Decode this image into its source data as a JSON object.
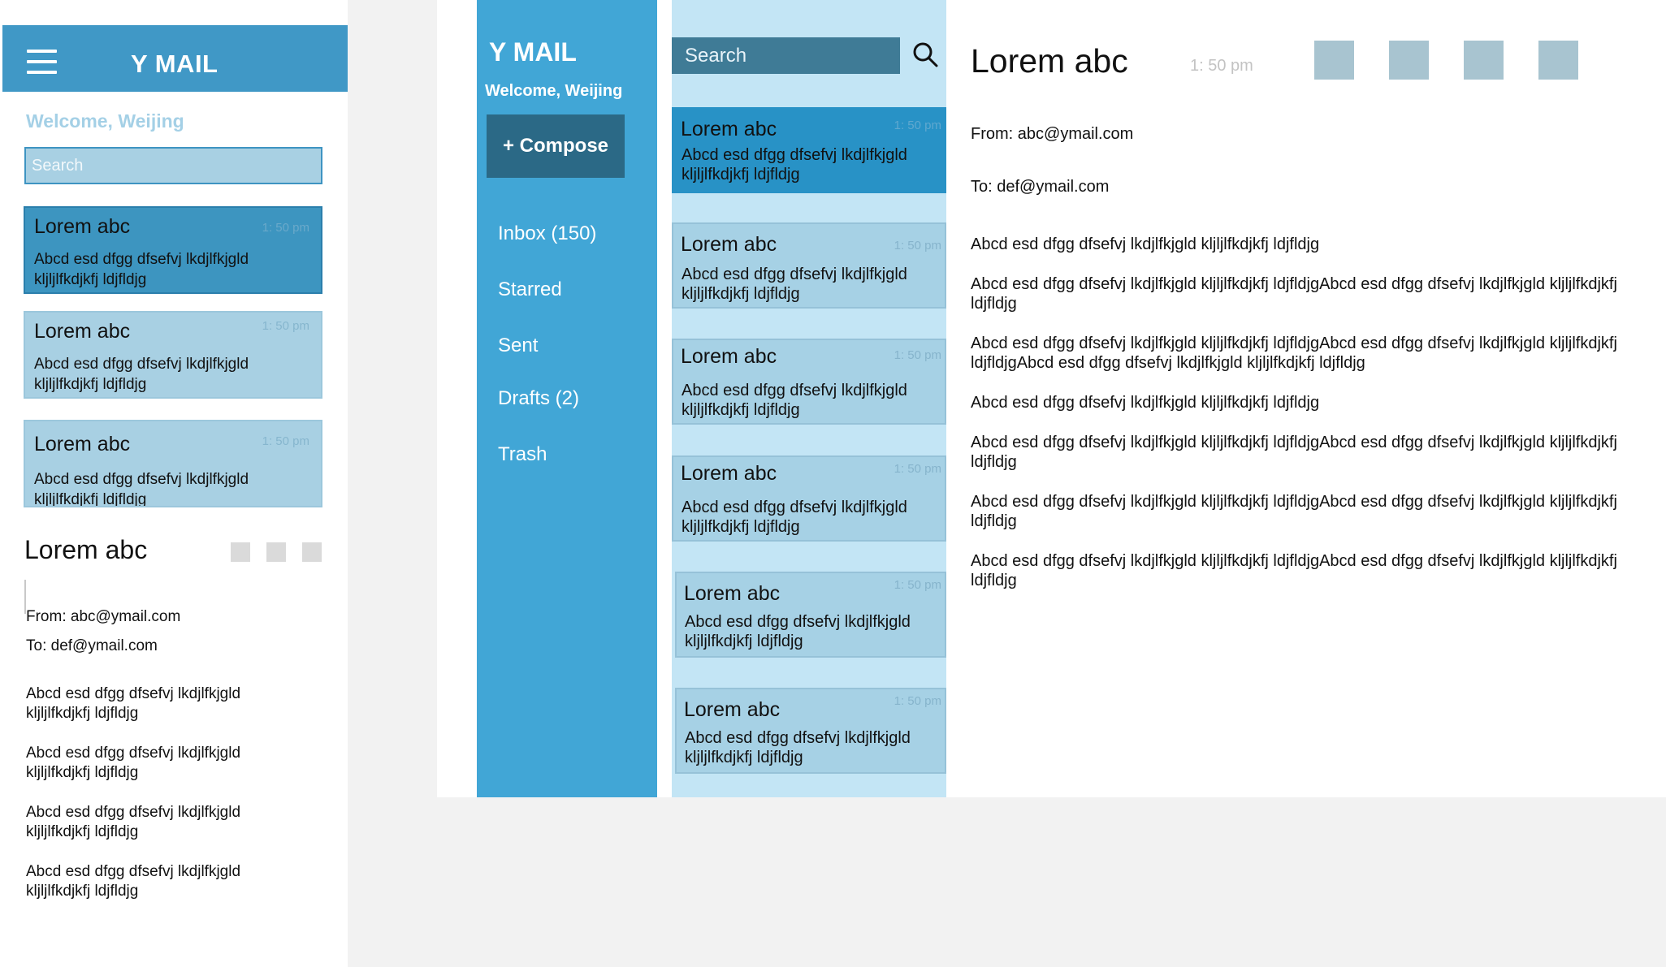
{
  "mobile": {
    "app_title": "Y MAIL",
    "welcome": "Welcome, Weijing",
    "search_placeholder": "Search",
    "emails": [
      {
        "subject": "Lorem abc",
        "time": "1: 50 pm",
        "snippet": "Abcd esd dfgg dfsefvj  lkdjlfkjgld kljljlfkdjkfj ldjfldjg",
        "selected": true
      },
      {
        "subject": "Lorem abc",
        "time": "1: 50 pm",
        "snippet": "Abcd esd dfgg dfsefvj  lkdjlfkjgld kljljlfkdjkfj ldjfldjg",
        "selected": false
      },
      {
        "subject": "Lorem abc",
        "time": "1: 50 pm",
        "snippet": "Abcd esd dfgg dfsefvj  lkdjlfkjgld kljljlfkdjkfj ldjfldjg",
        "selected": false
      }
    ],
    "reader": {
      "subject": "Lorem abc",
      "from": "From: abc@ymail.com",
      "to": "To: def@ymail.com",
      "paragraphs": [
        "Abcd esd dfgg dfsefvj  lkdjlfkjgld kljljlfkdjkfj ldjfldjg",
        "Abcd esd dfgg dfsefvj  lkdjlfkjgld kljljlfkdjkfj ldjfldjg",
        "Abcd esd dfgg dfsefvj  lkdjlfkjgld kljljlfkdjkfj ldjfldjg",
        "Abcd esd dfgg dfsefvj  lkdjlfkjgld kljljlfkdjkfj ldjfldjg"
      ]
    }
  },
  "desktop": {
    "app_title": "Y MAIL",
    "welcome": "Welcome, Weijing",
    "compose_label": "+ Compose",
    "nav": [
      {
        "label": "Inbox (150)"
      },
      {
        "label": "Starred"
      },
      {
        "label": "Sent"
      },
      {
        "label": "Drafts (2)"
      },
      {
        "label": "Trash"
      }
    ],
    "search_placeholder": "Search",
    "emails": [
      {
        "subject": "Lorem abc",
        "time": "1: 50 pm",
        "snippet": "Abcd esd dfgg dfsefvj  lkdjlfkjgld kljljlfkdjkfj ldjfldjg",
        "selected": true
      },
      {
        "subject": "Lorem abc",
        "time": "1: 50 pm",
        "snippet": "Abcd esd dfgg dfsefvj  lkdjlfkjgld kljljlfkdjkfj ldjfldjg",
        "selected": false
      },
      {
        "subject": "Lorem abc",
        "time": "1: 50 pm",
        "snippet": "Abcd esd dfgg dfsefvj  lkdjlfkjgld kljljlfkdjkfj ldjfldjg",
        "selected": false
      },
      {
        "subject": "Lorem abc",
        "time": "1: 50 pm",
        "snippet": "Abcd esd dfgg dfsefvj  lkdjlfkjgld kljljlfkdjkfj ldjfldjg",
        "selected": false
      },
      {
        "subject": "Lorem abc",
        "time": "1: 50 pm",
        "snippet": "Abcd esd dfgg dfsefvj  lkdjlfkjgld kljljlfkdjkfj ldjfldjg",
        "selected": false
      },
      {
        "subject": "Lorem abc",
        "time": "1: 50 pm",
        "snippet": "Abcd esd dfgg dfsefvj  lkdjlfkjgld kljljlfkdjkfj ldjfldjg",
        "selected": false
      }
    ],
    "reader": {
      "subject": "Lorem abc",
      "time": "1: 50 pm",
      "from": "From: abc@ymail.com",
      "to": "To: def@ymail.com",
      "paragraphs": [
        "Abcd esd dfgg dfsefvj  lkdjlfkjgld kljljlfkdjkfj ldjfldjg",
        "Abcd esd dfgg dfsefvj  lkdjlfkjgld kljljlfkdjkfj ldjfldjgAbcd esd dfgg dfsefvj  lkdjlfkjgld kljljlfkdjkfj ldjfldjg",
        "Abcd esd dfgg dfsefvj  lkdjlfkjgld kljljlfkdjkfj ldjfldjgAbcd esd dfgg dfsefvj  lkdjlfkjgld kljljlfkdjkfj ldjfldjgAbcd esd dfgg dfsefvj  lkdjlfkjgld kljljlfkdjkfj ldjfldjg",
        "Abcd esd dfgg dfsefvj  lkdjlfkjgld kljljlfkdjkfj ldjfldjg",
        "Abcd esd dfgg dfsefvj  lkdjlfkjgld kljljlfkdjkfj ldjfldjgAbcd esd dfgg dfsefvj  lkdjlfkjgld kljljlfkdjkfj ldjfldjg",
        "Abcd esd dfgg dfsefvj  lkdjlfkjgld kljljlfkdjkfj ldjfldjgAbcd esd dfgg dfsefvj  lkdjlfkjgld kljljlfkdjkfj ldjfldjg",
        "Abcd esd dfgg dfsefvj  lkdjlfkjgld kljljlfkdjkfj ldjfldjgAbcd esd dfgg dfsefvj  lkdjlfkjgld kljljlfkdjkfj ldjfldjg"
      ]
    }
  },
  "colors": {
    "brand_blue": "#41a6d6",
    "header_blue": "#4098c6",
    "selected_card": "#2892c6",
    "card": "#a6d1e5",
    "list_bg": "#c3e5f5",
    "compose": "#2b6986",
    "action_square": "#a8c4d0"
  },
  "icons": {
    "menu": "hamburger-icon",
    "search": "search-icon"
  }
}
